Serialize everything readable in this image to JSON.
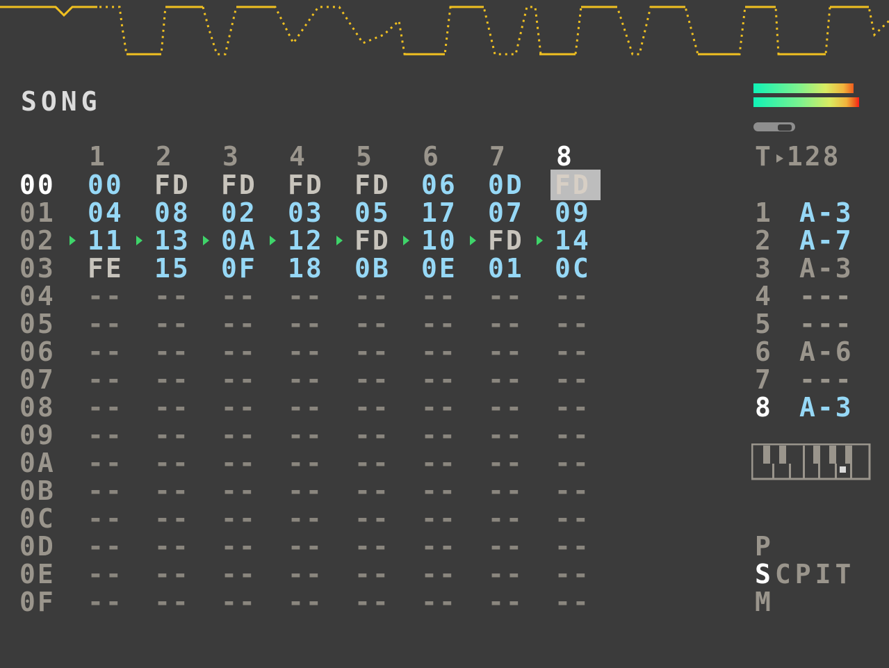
{
  "screen_title": "SONG",
  "column_headers": [
    "1",
    "2",
    "3",
    "4",
    "5",
    "6",
    "7",
    "8"
  ],
  "current_track": "8",
  "rows": [
    {
      "index": "00",
      "current": true,
      "cells": [
        "00",
        "FD",
        "FD",
        "FD",
        "FD",
        "06",
        "0D",
        "FD"
      ]
    },
    {
      "index": "01",
      "current": false,
      "cells": [
        "04",
        "08",
        "02",
        "03",
        "05",
        "17",
        "07",
        "09"
      ]
    },
    {
      "index": "02",
      "current": false,
      "playing": true,
      "cells": [
        "11",
        "13",
        "0A",
        "12",
        "FD",
        "10",
        "FD",
        "14"
      ]
    },
    {
      "index": "03",
      "current": false,
      "cells": [
        "FE",
        "15",
        "0F",
        "18",
        "0B",
        "0E",
        "01",
        "0C"
      ]
    },
    {
      "index": "04",
      "current": false,
      "cells": [
        "--",
        "--",
        "--",
        "--",
        "--",
        "--",
        "--",
        "--"
      ]
    },
    {
      "index": "05",
      "current": false,
      "cells": [
        "--",
        "--",
        "--",
        "--",
        "--",
        "--",
        "--",
        "--"
      ]
    },
    {
      "index": "06",
      "current": false,
      "cells": [
        "--",
        "--",
        "--",
        "--",
        "--",
        "--",
        "--",
        "--"
      ]
    },
    {
      "index": "07",
      "current": false,
      "cells": [
        "--",
        "--",
        "--",
        "--",
        "--",
        "--",
        "--",
        "--"
      ]
    },
    {
      "index": "08",
      "current": false,
      "cells": [
        "--",
        "--",
        "--",
        "--",
        "--",
        "--",
        "--",
        "--"
      ]
    },
    {
      "index": "09",
      "current": false,
      "cells": [
        "--",
        "--",
        "--",
        "--",
        "--",
        "--",
        "--",
        "--"
      ]
    },
    {
      "index": "0A",
      "current": false,
      "cells": [
        "--",
        "--",
        "--",
        "--",
        "--",
        "--",
        "--",
        "--"
      ]
    },
    {
      "index": "0B",
      "current": false,
      "cells": [
        "--",
        "--",
        "--",
        "--",
        "--",
        "--",
        "--",
        "--"
      ]
    },
    {
      "index": "0C",
      "current": false,
      "cells": [
        "--",
        "--",
        "--",
        "--",
        "--",
        "--",
        "--",
        "--"
      ]
    },
    {
      "index": "0D",
      "current": false,
      "cells": [
        "--",
        "--",
        "--",
        "--",
        "--",
        "--",
        "--",
        "--"
      ]
    },
    {
      "index": "0E",
      "current": false,
      "cells": [
        "--",
        "--",
        "--",
        "--",
        "--",
        "--",
        "--",
        "--"
      ]
    },
    {
      "index": "0F",
      "current": false,
      "cells": [
        "--",
        "--",
        "--",
        "--",
        "--",
        "--",
        "--",
        "--"
      ]
    }
  ],
  "cursor": {
    "row": 0,
    "col": 7
  },
  "tempo": {
    "label": "T",
    "value": "128"
  },
  "track_notes": [
    {
      "track": "1",
      "note": "A-3",
      "active": true
    },
    {
      "track": "2",
      "note": "A-7",
      "active": true
    },
    {
      "track": "3",
      "note": "A-3",
      "active": false
    },
    {
      "track": "4",
      "note": "---",
      "active": false
    },
    {
      "track": "5",
      "note": "---",
      "active": false
    },
    {
      "track": "6",
      "note": "A-6",
      "active": false
    },
    {
      "track": "7",
      "note": "---",
      "active": false
    },
    {
      "track": "8",
      "note": "A-3",
      "active": true
    }
  ],
  "screen_map": {
    "top": "P",
    "middle_current": "S",
    "middle_rest": "CPIT",
    "bottom": "M"
  },
  "colors": {
    "background": "#3b3b3b",
    "pattern_blue": "#96d8f6",
    "oscilloscope": "#f0c020",
    "play_marker": "#3fd46a",
    "cursor_bg": "#bdbdbd"
  },
  "meters": {
    "left_level": 0.95,
    "right_level": 1.0
  },
  "volume_slider_level": 0.6,
  "icons": [
    "play-marker-icon",
    "tempo-play-icon",
    "piano-keyboard-icon"
  ]
}
